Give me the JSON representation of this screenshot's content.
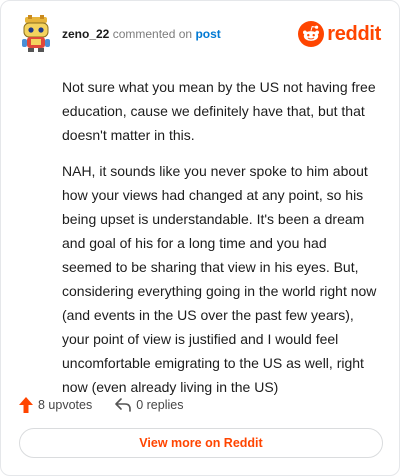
{
  "header": {
    "username": "zeno_22",
    "action_text": "commented on",
    "post_link": "post",
    "brand": "reddit"
  },
  "comment": {
    "paragraphs": [
      "Not sure what you mean by the US not having free education, cause we definitely have that, but that doesn't matter in this.",
      "NAH, it sounds like you never spoke to him about how your views had changed at any point, so his being upset is understandable. It's been a dream and goal of his for a long time and you had seemed to be sharing that view in his eyes. But, considering everything going in the world right now (and events in the US over the past few years), your point of view is justified and I would feel uncomfortable emigrating to the US as well, right now (even already living in the US)"
    ]
  },
  "footer": {
    "upvotes": "8 upvotes",
    "replies": "0 replies",
    "view_more": "View more on Reddit"
  },
  "colors": {
    "accent": "#ff4500",
    "link": "#0079d3",
    "text": "#1c1c1c",
    "muted": "#7c7c7c"
  },
  "icons": {
    "avatar": "snoo-avatar-icon",
    "brand": "reddit-logo-icon",
    "upvote": "upvote-arrow-icon",
    "reply": "reply-arrow-icon"
  }
}
